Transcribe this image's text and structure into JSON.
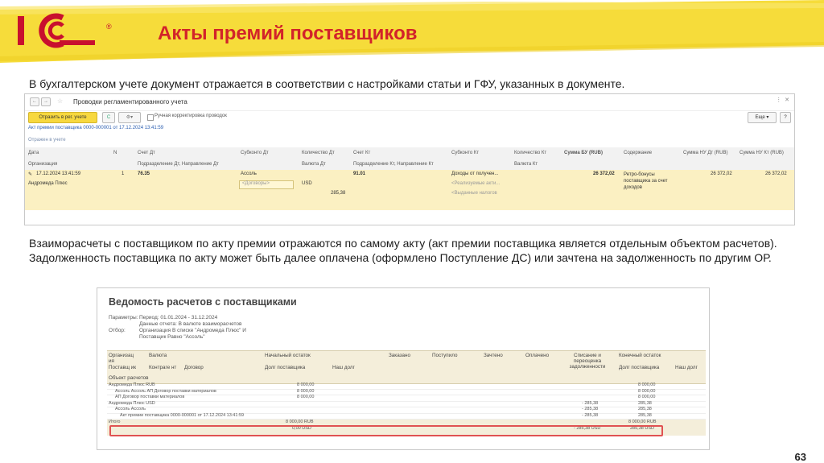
{
  "header": {
    "logo": "1С",
    "title": "Акты премий поставщиков"
  },
  "paragraph1": "В бухгалтерском учете документ отражается в соответствии с настройками статьи и ГФУ, указанных в документе.",
  "paragraph2": "Взаиморасчеты с поставщиком по акту премии отражаются по самому акту (акт премии поставщика является отдельным объектом расчетов). Задолженность поставщика по акту может быть далее оплачена (оформлено Поступление ДС) или зачтена на задолженность по другим ОР.",
  "screenshot1": {
    "title": "Проводки регламентированного учета",
    "btn_primary": "Отразить в рег. учете",
    "btn_refresh": "С",
    "btn_settings": "⚙▾",
    "manual_label": "Ручная корректировка проводок",
    "btn_more": "Еще ▾",
    "btn_help": "?",
    "doc_link": "Акт премии поставщика 0000-000001 от 17.12.2024 13:41:59",
    "reflected": "Отражен в учете",
    "headers_row1": [
      "Дата",
      "N",
      "Счет Дт",
      "Субконто Дт",
      "Количество Дт",
      "Счет Кт",
      "Субконто Кт",
      "Количество Кт",
      "Сумма БУ (RUB)",
      "Содержание",
      "Сумма НУ Дт (RUB)",
      "Сумма НУ Кт (RUB)"
    ],
    "headers_row2": [
      "Организация",
      "Подразделение Дт, Направление Дт",
      "Валюта Дт",
      "Подразделение Кт, Направление Кт",
      "Валюта Кт"
    ],
    "row": {
      "date": "17.12.2024 13:41:59",
      "n": "1",
      "debit": "76.35",
      "org": "Андромеда Плюс",
      "subconto_dt1": "Ассоль",
      "subconto_dt2": "<Договоры>",
      "currency": "USD",
      "amount_cur": "285,38",
      "credit": "91.01",
      "subconto_kt1": "Доходы от получен...",
      "subconto_kt2": "<Реализуемые акти...",
      "subconto_kt3": "<Выданные налогов",
      "sum": "26 372,02",
      "content": "Ретро-бонусы поставщика за счет доходов",
      "nu_dt": "26 372,02",
      "nu_kt": "26 372,02"
    }
  },
  "screenshot2": {
    "title": "Ведомость расчетов с поставщиками",
    "params_label": "Параметры:",
    "params_lines": [
      "Период: 01.01.2024 - 31.12.2024",
      "Данные отчета: В валюте взаиморасчетов"
    ],
    "filter_label": "Отбор:",
    "filter_lines": [
      "Организация В списке \"Андромеда Плюс\" И",
      "Поставщик Равно \"Ассоль\""
    ],
    "headers": {
      "org": "Организац ия",
      "currency": "Валюта",
      "supplier": "Поставщ ик",
      "counterparty": "Контраге нт",
      "contract": "Договор",
      "object": "Объект расчетов",
      "opening": "Начальный остаток",
      "supplier_debt": "Долг поставщика",
      "our_debt": "Наш долг",
      "ordered": "Заказано",
      "received": "Поступило",
      "offset": "Зачтено",
      "paid": "Оплачено",
      "written_off": "Списание и переоценка задолженности",
      "closing": "Конечный остаток",
      "closing_supplier": "Долг поставщика",
      "closing_our": "Наш долг"
    },
    "rows": [
      {
        "label": "Андромеда Плюс RUB",
        "opening": "8 000,00",
        "written": "",
        "closing": "8 000,00"
      },
      {
        "label": "Ассоль    Ассоль    АП Договор поставки материалов",
        "opening": "8 000,00",
        "written": "",
        "closing": "8 000,00"
      },
      {
        "label": "АП Договор поставки материалов",
        "opening": "8 000,00",
        "written": "",
        "closing": "8 000,00"
      },
      {
        "label": "Андромеда Плюс USD",
        "opening": "",
        "written": "- 285,38",
        "closing": "285,38"
      },
      {
        "label": "Ассоль    Ассоль",
        "opening": "",
        "written": "- 285,38",
        "closing": "285,38"
      },
      {
        "label": "Акт премии поставщика 0000-000001 от 17.12.2024 13:41:59",
        "opening": "",
        "written": "- 285,38",
        "closing": "285,38"
      }
    ],
    "total_label": "Итого",
    "total_opening": [
      "8 000,00 RUB",
      "0,00 USD"
    ],
    "total_written": [
      "",
      "- 285,38 USD"
    ],
    "total_closing": [
      "8 000,00 RUB",
      "285,38 USD"
    ]
  },
  "page_number": "63",
  "colors": {
    "brand_red": "#d2232a",
    "band_yellow": "#f6dc3a",
    "highlight_red": "#e05252"
  }
}
